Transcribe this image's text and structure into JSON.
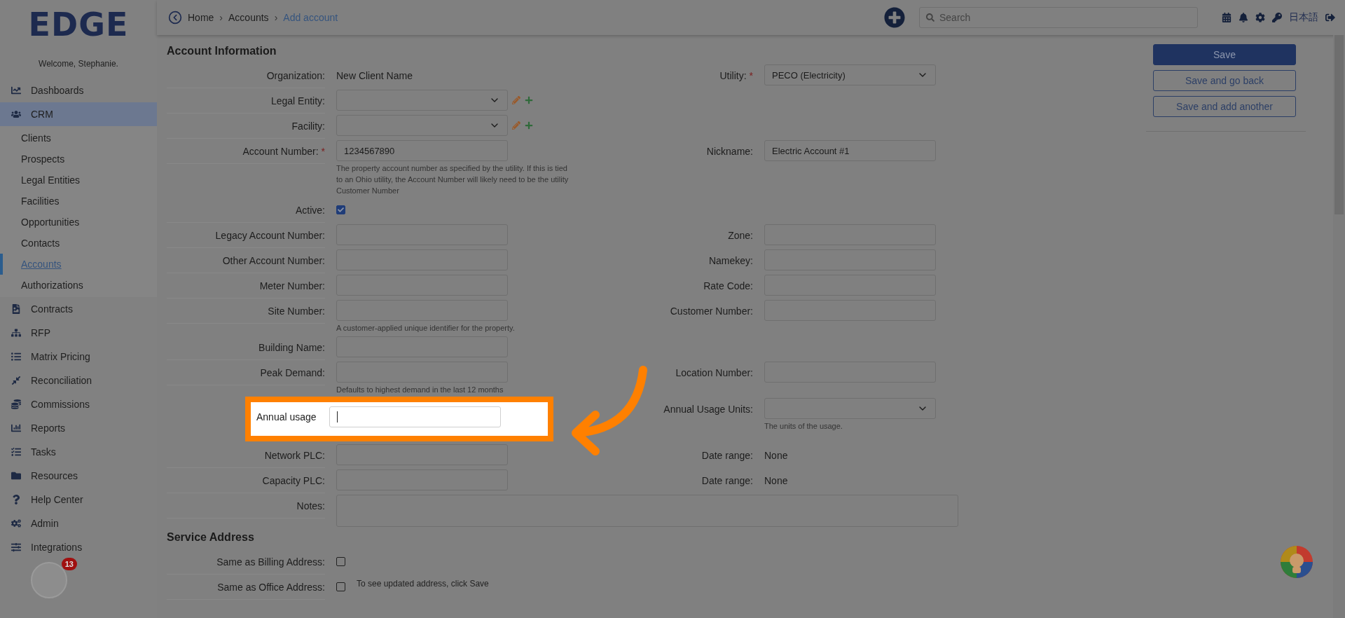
{
  "sidebar": {
    "logo": "EDGE",
    "welcome": "Welcome, Stephanie.",
    "items": [
      {
        "label": "Dashboards",
        "selected": false
      },
      {
        "label": "CRM",
        "selected": true,
        "expanded": true,
        "children": [
          {
            "label": "Clients",
            "selected": false
          },
          {
            "label": "Prospects",
            "selected": false
          },
          {
            "label": "Legal Entities",
            "selected": false
          },
          {
            "label": "Facilities",
            "selected": false
          },
          {
            "label": "Opportunities",
            "selected": false
          },
          {
            "label": "Contacts",
            "selected": false
          },
          {
            "label": "Accounts",
            "selected": true
          },
          {
            "label": "Authorizations",
            "selected": false
          }
        ]
      },
      {
        "label": "Contracts",
        "selected": false
      },
      {
        "label": "RFP",
        "selected": false
      },
      {
        "label": "Matrix Pricing",
        "selected": false
      },
      {
        "label": "Reconciliation",
        "selected": false
      },
      {
        "label": "Commissions",
        "selected": false
      },
      {
        "label": "Reports",
        "selected": false
      },
      {
        "label": "Tasks",
        "selected": false
      },
      {
        "label": "Resources",
        "selected": false
      },
      {
        "label": "Help Center",
        "selected": false
      },
      {
        "label": "Admin",
        "selected": false
      },
      {
        "label": "Integrations",
        "selected": false
      }
    ]
  },
  "welcome_widget": {
    "badge": "13"
  },
  "required_mark": "*",
  "topbar": {
    "separator": "›",
    "breadcrumbs": [
      {
        "label": "Home",
        "current": false
      },
      {
        "label": "Accounts",
        "current": false
      },
      {
        "label": "Add account",
        "current": true
      }
    ],
    "search": {
      "placeholder": "Search"
    },
    "language": "日本語"
  },
  "form": {
    "sections": [
      {
        "title": "Account Information",
        "rows": [
          {
            "left": {
              "label": "Organization:",
              "kind": "static",
              "value": "New Client Name"
            },
            "right": {
              "label": "Utility:",
              "required": true,
              "kind": "select",
              "value": "PECO (Electricity)"
            }
          },
          {
            "left": {
              "label": "Legal Entity:",
              "kind": "select",
              "editable": true
            }
          },
          {
            "left": {
              "label": "Facility:",
              "kind": "select",
              "editable": true
            }
          },
          {
            "left": {
              "label": "Account Number:",
              "required": true,
              "kind": "text",
              "value": "1234567890",
              "hint": "The property account number as specified by the utility. If this is tied to an Ohio utility, the Account Number will likely need to be the utility Customer Number"
            },
            "right": {
              "label": "Nickname:",
              "kind": "text",
              "value": "Electric Account #1"
            }
          },
          {
            "left": {
              "label": "Active:",
              "kind": "checkbox",
              "checked": true
            }
          },
          {
            "left": {
              "label": "Legacy Account Number:",
              "kind": "text"
            },
            "right": {
              "label": "Zone:",
              "kind": "text"
            }
          },
          {
            "left": {
              "label": "Other Account Number:",
              "kind": "text"
            },
            "right": {
              "label": "Namekey:",
              "kind": "text"
            }
          },
          {
            "left": {
              "label": "Meter Number:",
              "kind": "text"
            },
            "right": {
              "label": "Rate Code:",
              "kind": "text"
            }
          },
          {
            "left": {
              "label": "Site Number:",
              "kind": "text",
              "hint": "A customer-applied unique identifier for the property."
            },
            "right": {
              "label": "Customer Number:",
              "kind": "text"
            }
          },
          {
            "left": {
              "label": "Building Name:",
              "kind": "text"
            }
          },
          {
            "left": {
              "label": "Peak Demand:",
              "kind": "text",
              "hint": "Defaults to highest demand in the last 12 months"
            },
            "right": {
              "label": "Location Number:",
              "kind": "text"
            }
          },
          {
            "highlighted": true,
            "left": {
              "label": "Annual usage",
              "kind": "text",
              "focused": true
            },
            "right": {
              "label": "Annual Usage Units:",
              "kind": "select",
              "hint": "The units of the usage."
            }
          },
          {
            "left": {
              "label": "Network PLC:",
              "kind": "text"
            },
            "right": {
              "label": "Date range:",
              "kind": "static",
              "value": "None"
            }
          },
          {
            "left": {
              "label": "Capacity PLC:",
              "kind": "text"
            },
            "right": {
              "label": "Date range:",
              "kind": "static",
              "value": "None"
            }
          },
          {
            "left": {
              "label": "Notes:",
              "kind": "textarea"
            }
          }
        ]
      },
      {
        "title": "Service Address",
        "rows": [
          {
            "left": {
              "label": "Same as Billing Address:",
              "kind": "checkbox",
              "checked": false
            }
          },
          {
            "left": {
              "label": "Same as Office Address:",
              "kind": "checkbox",
              "checked": false,
              "note": "To see updated address, click Save"
            }
          }
        ]
      }
    ]
  },
  "actions": [
    {
      "label": "Save",
      "primary": true
    },
    {
      "label": "Save and go back",
      "primary": false
    },
    {
      "label": "Save and add another",
      "primary": false
    }
  ]
}
